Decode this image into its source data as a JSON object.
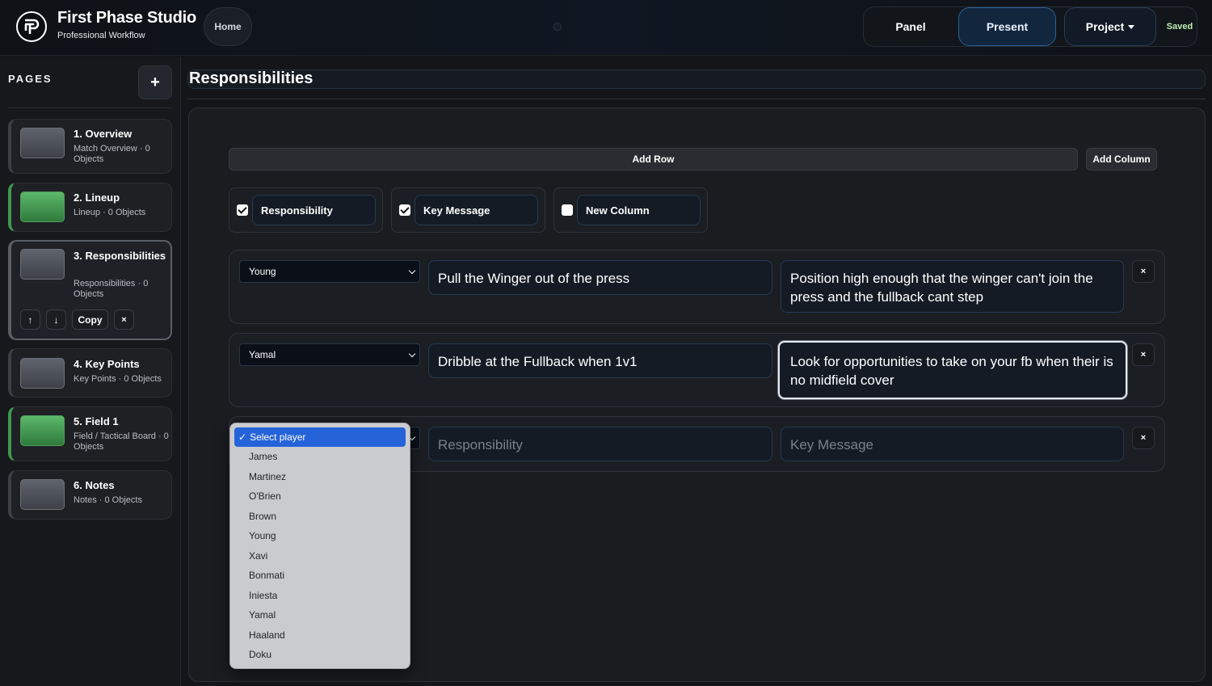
{
  "header": {
    "brand_title": "First Phase Studio",
    "brand_subtitle": "Professional Workflow",
    "home": "Home",
    "buttons": {
      "panel": "Panel",
      "present": "Present",
      "project": "Project",
      "saved": "Saved"
    }
  },
  "sidebar": {
    "label": "PAGES",
    "add": "+",
    "pages": [
      {
        "title": "1. Overview",
        "subtitle": "Match Overview · 0 Objects",
        "thumb": "gray"
      },
      {
        "title": "2. Lineup",
        "subtitle": "Lineup · 0 Objects",
        "thumb": "green"
      },
      {
        "title": "3. Responsibilities",
        "subtitle": "Responsibilities · 0 Objects",
        "thumb": "gray",
        "active": true
      },
      {
        "title": "4. Key Points",
        "subtitle": "Key Points · 0 Objects",
        "thumb": "gray"
      },
      {
        "title": "5. Field 1",
        "subtitle": "Field / Tactical Board · 0 Objects",
        "thumb": "green"
      },
      {
        "title": "6. Notes",
        "subtitle": "Notes · 0 Objects",
        "thumb": "gray"
      }
    ],
    "active_controls": {
      "up": "↑",
      "down": "↓",
      "copy": "Copy",
      "delete": "×"
    }
  },
  "main": {
    "title": "Responsibilities",
    "add_row": "Add Row",
    "add_column": "Add Column",
    "columns": [
      {
        "name": "Responsibility",
        "checked": true
      },
      {
        "name": "Key Message",
        "checked": true
      },
      {
        "name": "New Column",
        "checked": false
      }
    ],
    "rows": [
      {
        "player": "Young",
        "responsibility": "Pull the Winger out of the press",
        "key_message": "Position high enough that the winger can't join the press and the fullback cant step"
      },
      {
        "player": "Yamal",
        "responsibility": "Dribble at the Fullback when 1v1",
        "key_message": "Look for opportunities to take on your fb when their is no midfield cover"
      },
      {
        "player": "Select player",
        "responsibility_placeholder": "Responsibility",
        "key_message_placeholder": "Key Message"
      }
    ],
    "delete": "×"
  },
  "dropdown": {
    "selected": "Select player",
    "options": [
      "James",
      "Martinez",
      "O'Brien",
      "Brown",
      "Young",
      "Xavi",
      "Bonmati",
      "Iniesta",
      "Yamal",
      "Haaland",
      "Doku"
    ]
  },
  "colors": {
    "accent": "#2563d9",
    "present_border": "#2b5f92",
    "saved": "#bff0b0",
    "page_green": "#3b9a4f"
  }
}
